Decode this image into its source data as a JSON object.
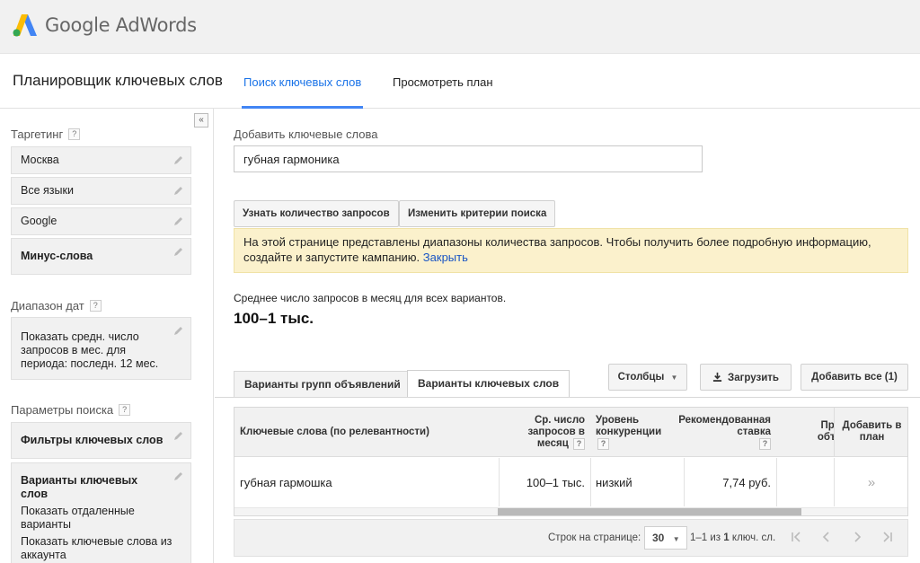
{
  "header": {
    "logo_text": "Google AdWords"
  },
  "subheader": {
    "title": "Планировщик ключевых слов",
    "tabs": [
      {
        "label": "Поиск ключевых слов",
        "active": true
      },
      {
        "label": "Просмотреть план",
        "active": false
      }
    ]
  },
  "sidebar": {
    "collapse_label": "«",
    "targeting": {
      "label": "Таргетинг",
      "help": "?",
      "items": [
        "Москва",
        "Все языки",
        "Google",
        "Минус-слова"
      ]
    },
    "dates": {
      "label": "Диапазон дат",
      "help": "?",
      "text": "Показать средн. число запросов в мес. для периода: последн. 12 мес."
    },
    "search_params": {
      "label": "Параметры поиска",
      "help": "?",
      "filters": "Фильтры ключевых слов",
      "variants_title": "Варианты ключевых слов",
      "variants_line1": "Показать отдаленные варианты",
      "variants_line2": "Показать ключевые слова из аккаунта"
    }
  },
  "main": {
    "add_label": "Добавить ключевые слова",
    "keyword_value": "губная гармоника",
    "btn_get_volume": "Узнать количество запросов",
    "btn_modify": "Изменить критерии поиска",
    "notice_text": "На этой странице представлены диапазоны количества запросов. Чтобы получить более подробную информацию, создайте и запустите кампанию.",
    "notice_link": "Закрыть",
    "avg_label": "Среднее число запросов в месяц для всех вариантов.",
    "avg_value": "100–1 тыс.",
    "tabs": [
      {
        "label": "Варианты групп объявлений",
        "active": false
      },
      {
        "label": "Варианты ключевых слов",
        "active": true
      }
    ],
    "btn_columns": "Столбцы",
    "btn_download": "Загрузить",
    "btn_add_all": "Добавить все (1)",
    "table": {
      "headers": {
        "keyword": "Ключевые слова (по релевантности)",
        "avg": "Ср. число запросов в месяц",
        "competition": "Уровень конкуренции",
        "bid": "Рекомендованная ставка",
        "share": "Пр по объяв",
        "add": "Добавить в план"
      },
      "help": "?",
      "rows": [
        {
          "keyword": "губная гармошка",
          "avg": "100–1 тыс.",
          "competition": "низкий",
          "bid": "7,74 руб.",
          "add": "»"
        }
      ]
    },
    "footer": {
      "rows_label": "Строк на странице:",
      "rows_value": "30",
      "range_prefix": "1–1 из",
      "range_count": "1",
      "range_suffix": "ключ. сл."
    }
  },
  "colors": {
    "accent": "#4285f4",
    "notice_bg": "#fbf1cc",
    "link": "#1a55c4"
  }
}
